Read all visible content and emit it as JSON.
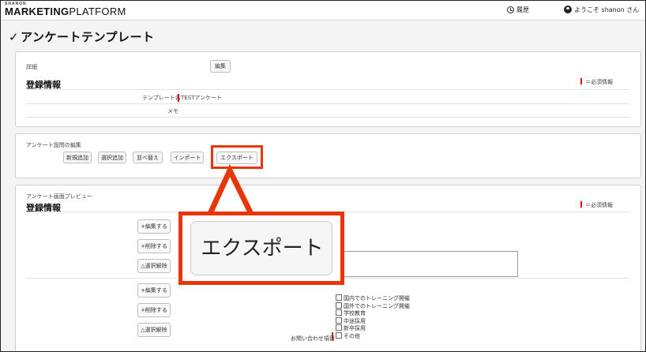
{
  "header": {
    "logo_small": "SHANON",
    "logo_main_bold": "MARKETING",
    "logo_main_rest": "PLATFORM",
    "history_label": "履歴",
    "user_greeting": "ようこそ shanon さん"
  },
  "page": {
    "check_mark": "✓",
    "title": "アンケートテンプレート"
  },
  "panel1": {
    "detail_label": "詳細",
    "edit_button": "編集",
    "section_title": "登録情報",
    "required_note": "＝必須情報",
    "template_name_label": "テンプレート名",
    "template_name_value": "TESTアンケート",
    "memo_label": "メモ"
  },
  "panel2": {
    "heading": "アンケート設問の編集",
    "buttons": [
      "新規追加",
      "選択追加",
      "並べ替え",
      "インポート"
    ],
    "export_button": "エクスポート"
  },
  "callout": {
    "text": "エクスポート",
    "color": "#e8360a"
  },
  "panel3": {
    "heading": "アンケート画面プレビュー",
    "section_title": "登録情報",
    "required_note": "＝必須情報",
    "group1_buttons": [
      "+編集する",
      "+削除する",
      "△選択解除"
    ],
    "group2_buttons": [
      "+編集する",
      "+削除する",
      "△選択解除"
    ],
    "checkbox_options": [
      "国内でのトレーニング開催",
      "国外でのトレーニング開催",
      "学校教育",
      "中途採用",
      "新卒採用",
      "その他"
    ],
    "question_label": "お問い合わせ項目"
  },
  "colors": {
    "accent": "#e8360a",
    "required": "#dd1111"
  }
}
